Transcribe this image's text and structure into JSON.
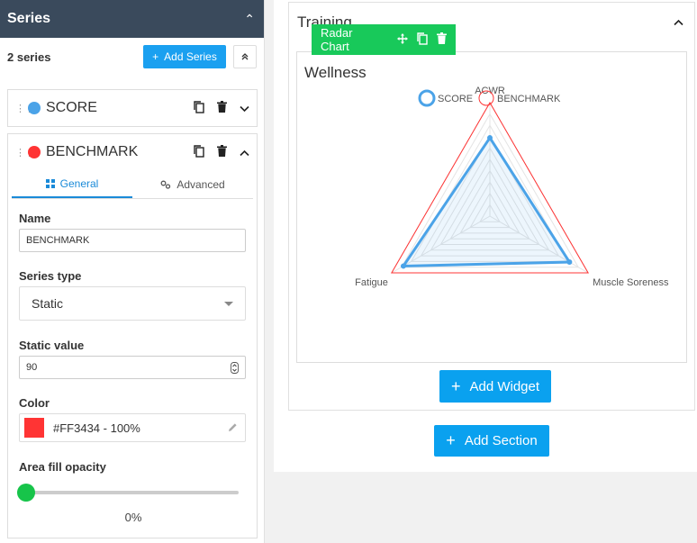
{
  "left": {
    "title": "Series",
    "count": "2 series",
    "add_series": "Add Series"
  },
  "series": [
    {
      "name": "SCORE",
      "color": "#4ba3e8"
    },
    {
      "name": "BENCHMARK",
      "color": "#ff3434"
    }
  ],
  "editor": {
    "tabs": [
      {
        "label": "General",
        "active": true
      },
      {
        "label": "Advanced",
        "active": false
      }
    ],
    "name_label": "Name",
    "name_value": "BENCHMARK",
    "series_type_label": "Series type",
    "series_type_value": "Static",
    "static_value_label": "Static value",
    "static_value": "90",
    "color_label": "Color",
    "color_value": "#FF3434 - 100%",
    "opacity_label": "Area fill opacity",
    "opacity_value": "0%",
    "opacity_fraction": 0
  },
  "section": {
    "title": "Training",
    "add_widget": "Add Widget",
    "add_section": "Add Section"
  },
  "widget": {
    "type_label": "Radar Chart",
    "title": "Wellness"
  },
  "chart_data": {
    "type": "radar",
    "title": "Wellness",
    "axes": [
      "ACWR",
      "Muscle Soreness",
      "Fatigue"
    ],
    "max": 100,
    "grid_levels": 10,
    "series": [
      {
        "name": "SCORE",
        "values": [
          69,
          81,
          88
        ],
        "color": "#4ba3e8",
        "fill": "rgba(75,163,232,0.10)"
      },
      {
        "name": "BENCHMARK",
        "values": [
          100,
          100,
          100
        ],
        "color": "#ff3434"
      }
    ],
    "legend": "top"
  }
}
